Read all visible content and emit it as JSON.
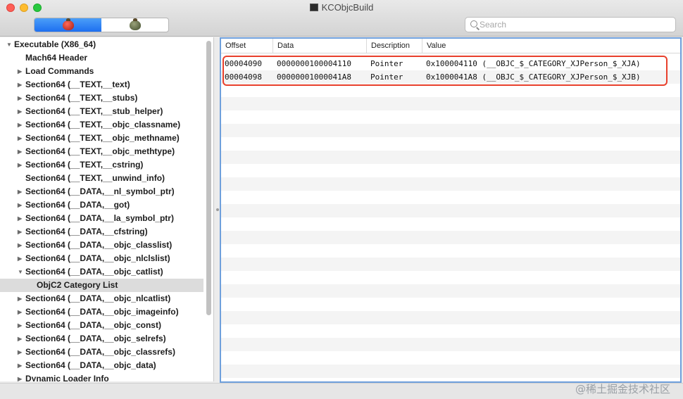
{
  "window": {
    "title": "KCObjcBuild"
  },
  "search": {
    "placeholder": "Search",
    "value": ""
  },
  "toolbar": {
    "segments": [
      "red-bug-icon",
      "green-bug-icon"
    ]
  },
  "sidebar": {
    "items": [
      {
        "label": "Executable  (X86_64)",
        "level": 0,
        "disclosure": "open"
      },
      {
        "label": "Mach64 Header",
        "level": 1,
        "disclosure": "none"
      },
      {
        "label": "Load Commands",
        "level": 1,
        "disclosure": "closed"
      },
      {
        "label": "Section64 (__TEXT,__text)",
        "level": 1,
        "disclosure": "closed"
      },
      {
        "label": "Section64 (__TEXT,__stubs)",
        "level": 1,
        "disclosure": "closed"
      },
      {
        "label": "Section64 (__TEXT,__stub_helper)",
        "level": 1,
        "disclosure": "closed"
      },
      {
        "label": "Section64 (__TEXT,__objc_classname)",
        "level": 1,
        "disclosure": "closed"
      },
      {
        "label": "Section64 (__TEXT,__objc_methname)",
        "level": 1,
        "disclosure": "closed"
      },
      {
        "label": "Section64 (__TEXT,__objc_methtype)",
        "level": 1,
        "disclosure": "closed"
      },
      {
        "label": "Section64 (__TEXT,__cstring)",
        "level": 1,
        "disclosure": "closed"
      },
      {
        "label": "Section64 (__TEXT,__unwind_info)",
        "level": 1,
        "disclosure": "none"
      },
      {
        "label": "Section64 (__DATA,__nl_symbol_ptr)",
        "level": 1,
        "disclosure": "closed"
      },
      {
        "label": "Section64 (__DATA,__got)",
        "level": 1,
        "disclosure": "closed"
      },
      {
        "label": "Section64 (__DATA,__la_symbol_ptr)",
        "level": 1,
        "disclosure": "closed"
      },
      {
        "label": "Section64 (__DATA,__cfstring)",
        "level": 1,
        "disclosure": "closed"
      },
      {
        "label": "Section64 (__DATA,__objc_classlist)",
        "level": 1,
        "disclosure": "closed"
      },
      {
        "label": "Section64 (__DATA,__objc_nlclslist)",
        "level": 1,
        "disclosure": "closed"
      },
      {
        "label": "Section64 (__DATA,__objc_catlist)",
        "level": 1,
        "disclosure": "open"
      },
      {
        "label": "ObjC2 Category List",
        "level": 2,
        "disclosure": "none",
        "selected": true
      },
      {
        "label": "Section64 (__DATA,__objc_nlcatlist)",
        "level": 1,
        "disclosure": "closed"
      },
      {
        "label": "Section64 (__DATA,__objc_imageinfo)",
        "level": 1,
        "disclosure": "closed"
      },
      {
        "label": "Section64 (__DATA,__objc_const)",
        "level": 1,
        "disclosure": "closed"
      },
      {
        "label": "Section64 (__DATA,__objc_selrefs)",
        "level": 1,
        "disclosure": "closed"
      },
      {
        "label": "Section64 (__DATA,__objc_classrefs)",
        "level": 1,
        "disclosure": "closed"
      },
      {
        "label": "Section64 (__DATA,__objc_data)",
        "level": 1,
        "disclosure": "closed"
      },
      {
        "label": "Dynamic Loader Info",
        "level": 1,
        "disclosure": "closed"
      }
    ]
  },
  "table": {
    "columns": [
      "Offset",
      "Data",
      "Description",
      "Value"
    ],
    "rows": [
      [
        "00004090",
        "0000000100004110",
        "Pointer",
        "0x100004110 (__OBJC_$_CATEGORY_XJPerson_$_XJA)"
      ],
      [
        "00004098",
        "00000001000041A8",
        "Pointer",
        "0x1000041A8 (__OBJC_$_CATEGORY_XJPerson_$_XJB)"
      ]
    ],
    "highlight_color": "#e8402c"
  },
  "watermark": "@稀土掘金技术社区",
  "colors": {
    "selection_blue": "#1d6ff0",
    "table_border": "#6fa0dc"
  }
}
